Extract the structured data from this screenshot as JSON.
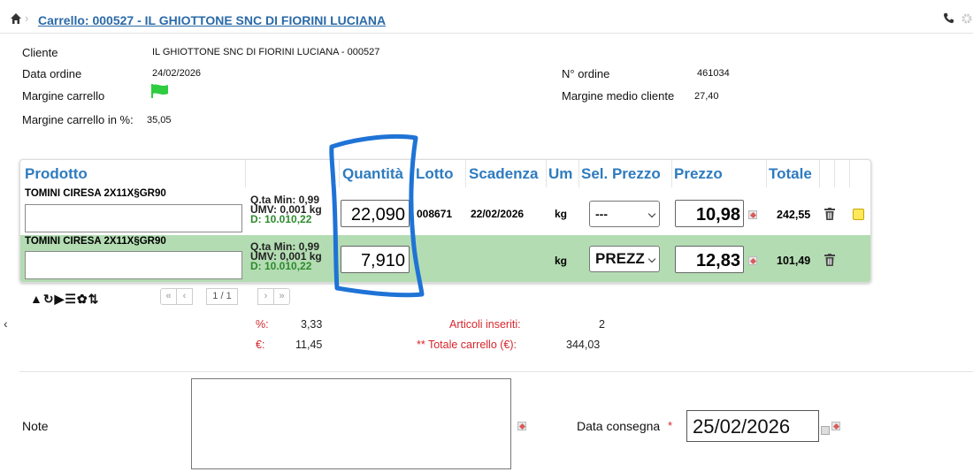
{
  "header": {
    "breadcrumb": "Carrello: 000527 - IL GHIOTTONE SNC DI FIORINI LUCIANA"
  },
  "info": {
    "cliente_label": "Cliente",
    "cliente_value": "IL GHIOTTONE SNC DI FIORINI LUCIANA - 000527",
    "data_label": "Data ordine",
    "data_value": "24/02/2026",
    "ordine_label": "N° ordine",
    "ordine_value": "461034",
    "margine_label": "Margine carrello",
    "margine_flag_color": "#2ecc40",
    "margine_medio_label": "Margine medio cliente",
    "margine_medio_value": "27,40",
    "margine_perc_label": "Margine carrello in %:",
    "margine_perc_value": "35,05"
  },
  "table": {
    "headers": [
      "Prodotto",
      "Quantità",
      "Lotto",
      "Scadenza",
      "Um",
      "Sel. Prezzo",
      "Prezzo",
      "Totale"
    ],
    "rows": [
      {
        "product": "TOMINI CIRESA 2X11X§GR90",
        "qmin": "Q.ta Min: 0,99",
        "umv": "UMV: 0,001 kg",
        "disp": "D: 10.010,22",
        "quantity": "22,090",
        "lotto": "008671",
        "scadenza": "22/02/2026",
        "um": "kg",
        "sel_prezzo": "---",
        "prezzo": "10,98",
        "totale": "242,55"
      },
      {
        "product": "TOMINI CIRESA 2X11X§GR90",
        "qmin": "Q.ta Min: 0,99",
        "umv": "UMV: 0,001 kg",
        "disp": "D: 10.010,22",
        "quantity": "7,910",
        "lotto": "",
        "scadenza": "",
        "um": "kg",
        "sel_prezzo": "PREZZ",
        "prezzo": "12,83",
        "totale": "101,49"
      }
    ]
  },
  "toolbar": {
    "icons": "▲↻▶☰✿⇅"
  },
  "pager": {
    "first": "«",
    "prev": "‹",
    "info": "1 / 1",
    "next": "›",
    "last": "»"
  },
  "summary": {
    "perc_label": "%:",
    "perc_value": "3,33",
    "euro_label": "€:",
    "euro_value": "11,45",
    "articoli_label": "Articoli inseriti:",
    "articoli_value": "2",
    "totale_label": "** Totale carrello (€):",
    "totale_value": "344,03"
  },
  "bottom": {
    "note_label": "Note",
    "consegna_label": "Data consegna",
    "required_mark": "*",
    "consegna_value": "25/02/2026"
  },
  "annotation": {
    "color": "#1f73d6"
  }
}
